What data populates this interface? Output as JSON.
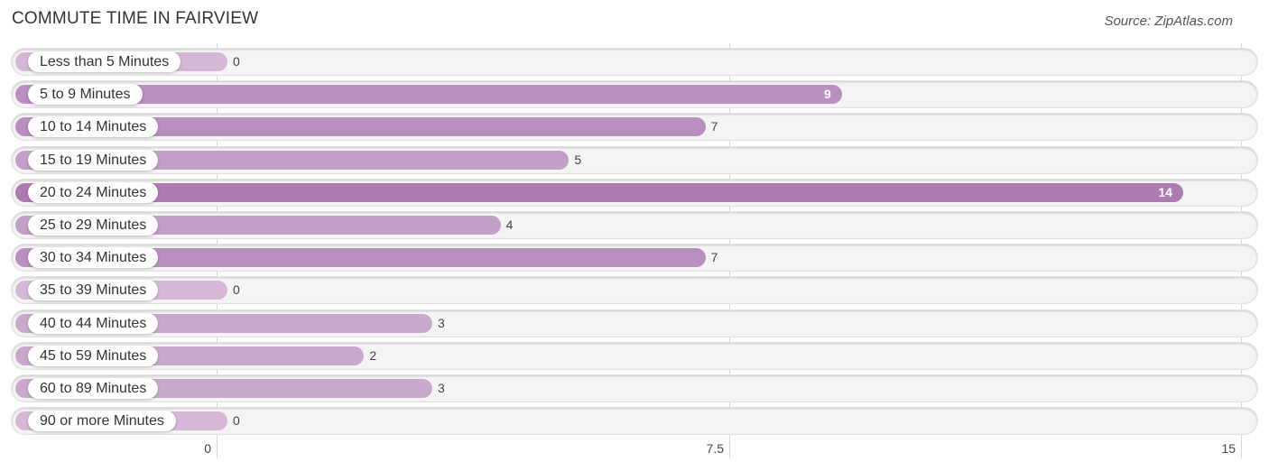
{
  "header": {
    "title": "COMMUTE TIME IN FAIRVIEW",
    "source": "Source: ZipAtlas.com"
  },
  "chart_data": {
    "type": "bar",
    "orientation": "horizontal",
    "title": "COMMUTE TIME IN FAIRVIEW",
    "source": "Source: ZipAtlas.com",
    "xlabel": "",
    "ylabel": "",
    "xlim": [
      0,
      15
    ],
    "xticks": [
      0,
      7.5,
      15
    ],
    "xtick_labels": [
      "0",
      "7.5",
      "15"
    ],
    "grid": true,
    "categories": [
      "Less than 5 Minutes",
      "5 to 9 Minutes",
      "10 to 14 Minutes",
      "15 to 19 Minutes",
      "20 to 24 Minutes",
      "25 to 29 Minutes",
      "30 to 34 Minutes",
      "35 to 39 Minutes",
      "40 to 44 Minutes",
      "45 to 59 Minutes",
      "60 to 89 Minutes",
      "90 or more Minutes"
    ],
    "values": [
      0,
      9,
      7,
      5,
      14,
      4,
      7,
      0,
      3,
      2,
      3,
      0
    ],
    "colors": {
      "max": "#ad7bb0",
      "high": "#b98fbf",
      "mid": "#c29fc6",
      "low": "#c9a9cb",
      "zero": "#d4b8d6"
    }
  }
}
